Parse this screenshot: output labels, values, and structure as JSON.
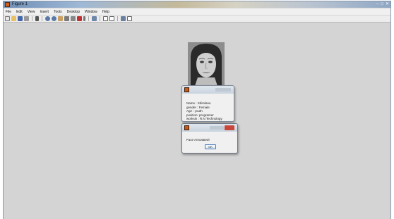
{
  "window": {
    "title": "Figure 1"
  },
  "menubar": {
    "items": [
      "File",
      "Edit",
      "View",
      "Insert",
      "Tools",
      "Desktop",
      "Window",
      "Help"
    ]
  },
  "info_dialog": {
    "lines": [
      "Name : Shimlanu",
      "gender : Female",
      "Age : youth",
      "position: programer",
      "worksin : R.N Technology"
    ]
  },
  "message_dialog": {
    "message": "Face Annotated!",
    "ok_label": "OK"
  }
}
